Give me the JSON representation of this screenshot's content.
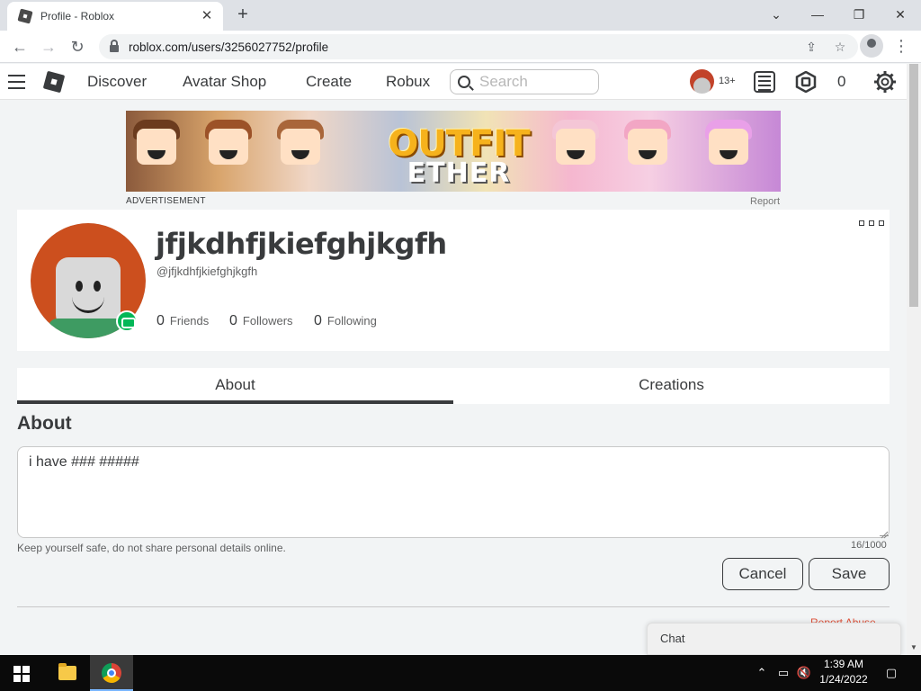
{
  "browser": {
    "tab_title": "Profile - Roblox",
    "url": "roblox.com/users/3256027752/profile",
    "icons": [
      "close-icon",
      "plus-icon",
      "minimize-icon",
      "maximize-icon",
      "back-icon",
      "forward-icon",
      "reload-icon",
      "lock-icon",
      "share-icon",
      "star-icon",
      "profile-icon",
      "more-vert-icon"
    ]
  },
  "header": {
    "nav": [
      "Discover",
      "Avatar Shop",
      "Create",
      "Robux"
    ],
    "search_placeholder": "Search",
    "age_label": "13+",
    "robux_count": "0"
  },
  "ad": {
    "title": "OUTFIT",
    "subtitle": "ETHER",
    "label": "ADVERTISEMENT",
    "report": "Report"
  },
  "profile": {
    "display_name": "jfjkdhfjkiefghjkgfh",
    "username": "@jfjkdhfjkiefghjkgfh",
    "stats": [
      {
        "count": "0",
        "label": "Friends"
      },
      {
        "count": "0",
        "label": "Followers"
      },
      {
        "count": "0",
        "label": "Following"
      }
    ]
  },
  "tabs": [
    {
      "label": "About",
      "active": true
    },
    {
      "label": "Creations",
      "active": false
    }
  ],
  "about": {
    "heading": "About",
    "text": "i have ### #####",
    "safety_note": "Keep yourself safe, do not share personal details online.",
    "char_count": "16/1000",
    "cancel_label": "Cancel",
    "save_label": "Save",
    "report_abuse": "Report Abuse"
  },
  "chat": {
    "label": "Chat"
  },
  "taskbar": {
    "time": "1:39 AM",
    "date": "1/24/2022"
  },
  "colors": {
    "roblox_text": "#393b3d",
    "online_badge": "#02b757",
    "report_abuse": "#e0523a"
  }
}
